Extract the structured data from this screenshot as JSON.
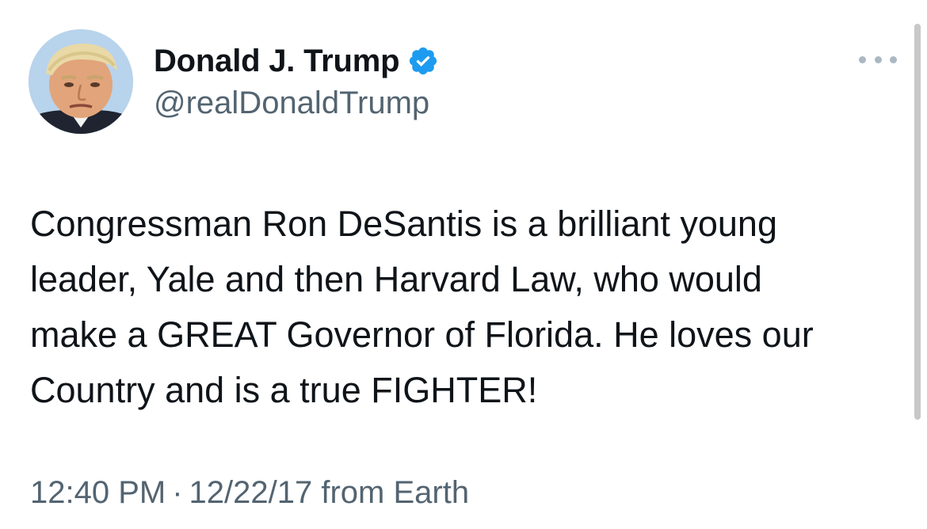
{
  "author": {
    "display_name": "Donald J. Trump",
    "handle": "@realDonaldTrump",
    "verified": true,
    "verified_color": "#1d9bf0"
  },
  "icons": {
    "more": "more-dots-icon",
    "verified": "verified-badge-icon",
    "avatar": "profile-avatar"
  },
  "tweet": {
    "lines": [
      "Congressman Ron DeSantis is a brilliant young",
      "leader, Yale and then Harvard Law, who would",
      "make a GREAT Governor of Florida. He loves our",
      "Country and is a true FIGHTER!"
    ]
  },
  "meta": {
    "time": "12:40 PM",
    "separator": "·",
    "date": "12/22/17",
    "source": "from Earth"
  },
  "colors": {
    "text": "#0f1419",
    "secondary": "#536471",
    "accent": "#1d9bf0"
  }
}
